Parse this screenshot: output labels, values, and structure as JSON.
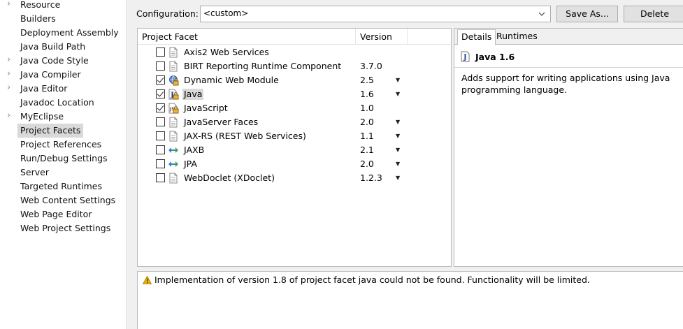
{
  "tree": {
    "items": [
      {
        "label": "Resource",
        "arrow": "›"
      },
      {
        "label": "Builders",
        "arrow": ""
      },
      {
        "label": "Deployment Assembly",
        "arrow": ""
      },
      {
        "label": "Java Build Path",
        "arrow": ""
      },
      {
        "label": "Java Code Style",
        "arrow": "›"
      },
      {
        "label": "Java Compiler",
        "arrow": "›"
      },
      {
        "label": "Java Editor",
        "arrow": "›"
      },
      {
        "label": "Javadoc Location",
        "arrow": ""
      },
      {
        "label": "MyEclipse",
        "arrow": "›"
      },
      {
        "label": "Project Facets",
        "arrow": ""
      },
      {
        "label": "Project References",
        "arrow": ""
      },
      {
        "label": "Run/Debug Settings",
        "arrow": ""
      },
      {
        "label": "Server",
        "arrow": ""
      },
      {
        "label": "Targeted Runtimes",
        "arrow": ""
      },
      {
        "label": "Web Content Settings",
        "arrow": ""
      },
      {
        "label": "Web Page Editor",
        "arrow": ""
      },
      {
        "label": "Web Project Settings",
        "arrow": ""
      }
    ],
    "selected": "Project Facets"
  },
  "config": {
    "label": "Configuration:",
    "value": "<custom>",
    "dropdown_icon": "chevron-down-icon",
    "save_as": "Save As...",
    "delete": "Delete"
  },
  "facets": {
    "col_facet": "Project Facet",
    "col_version": "Version",
    "rows": [
      {
        "name": "Axis2 Web Services",
        "checked": false,
        "icon": "page-icon",
        "version": "",
        "dropdown": false
      },
      {
        "name": "BIRT Reporting Runtime Component",
        "checked": false,
        "icon": "page-icon",
        "version": "3.7.0",
        "dropdown": false
      },
      {
        "name": "Dynamic Web Module",
        "checked": true,
        "icon": "web-module-lock-icon",
        "version": "2.5",
        "dropdown": true
      },
      {
        "name": "Java",
        "checked": true,
        "icon": "java-lock-icon",
        "version": "1.6",
        "dropdown": true
      },
      {
        "name": "JavaScript",
        "checked": true,
        "icon": "javascript-lock-icon",
        "version": "1.0",
        "dropdown": false
      },
      {
        "name": "JavaServer Faces",
        "checked": false,
        "icon": "page-icon",
        "version": "2.0",
        "dropdown": true
      },
      {
        "name": "JAX-RS (REST Web Services)",
        "checked": false,
        "icon": "page-icon",
        "version": "1.1",
        "dropdown": true
      },
      {
        "name": "JAXB",
        "checked": false,
        "icon": "jaxb-arrows-icon",
        "version": "2.1",
        "dropdown": true
      },
      {
        "name": "JPA",
        "checked": false,
        "icon": "jpa-arrows-icon",
        "version": "2.0",
        "dropdown": true
      },
      {
        "name": "WebDoclet (XDoclet)",
        "checked": false,
        "icon": "page-icon",
        "version": "1.2.3",
        "dropdown": true
      }
    ],
    "selected": "Java",
    "dropdown_glyph": "▼"
  },
  "details": {
    "tabs": [
      "Details",
      "Runtimes"
    ],
    "active_tab": "Details",
    "title": "Java 1.6",
    "description": "Adds support for writing applications using Java programming language."
  },
  "problems": {
    "message": "Implementation of version 1.8 of project facet java could not be found. Functionality will be limited.",
    "icon": "warning-icon"
  },
  "colors": {
    "selection": "#d9d9d9",
    "panel_bg": "#f0f0f0",
    "border": "#bcbcbc",
    "java_icon": "#e8a317",
    "warning": "#f0b400"
  }
}
